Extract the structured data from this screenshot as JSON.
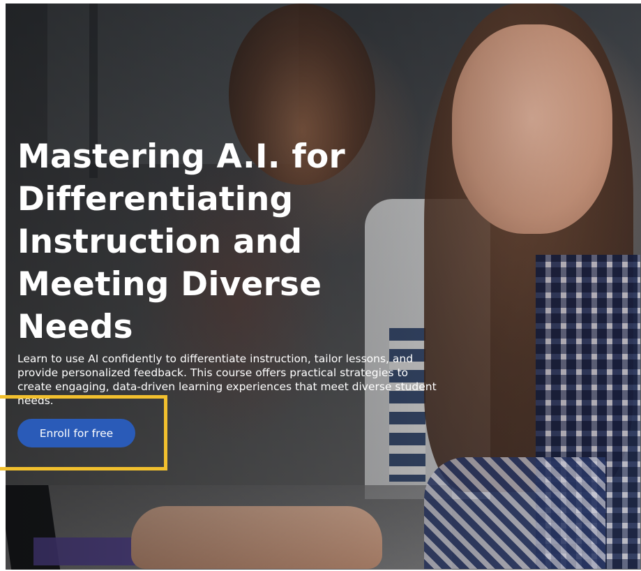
{
  "hero": {
    "title": "Mastering A.I. for Differentiating Instruction and Meeting Diverse Needs",
    "description": "Learn to use AI confidently to differentiate instruction, tailor lessons, and provide personalized feedback. This course offers practical strategies to create engaging, data-driven learning experiences that meet diverse student needs.",
    "enroll_label": "Enroll for free"
  },
  "colors": {
    "button_background": "#2a5bb8",
    "highlight_border": "#f2c02e",
    "text": "#ffffff"
  }
}
